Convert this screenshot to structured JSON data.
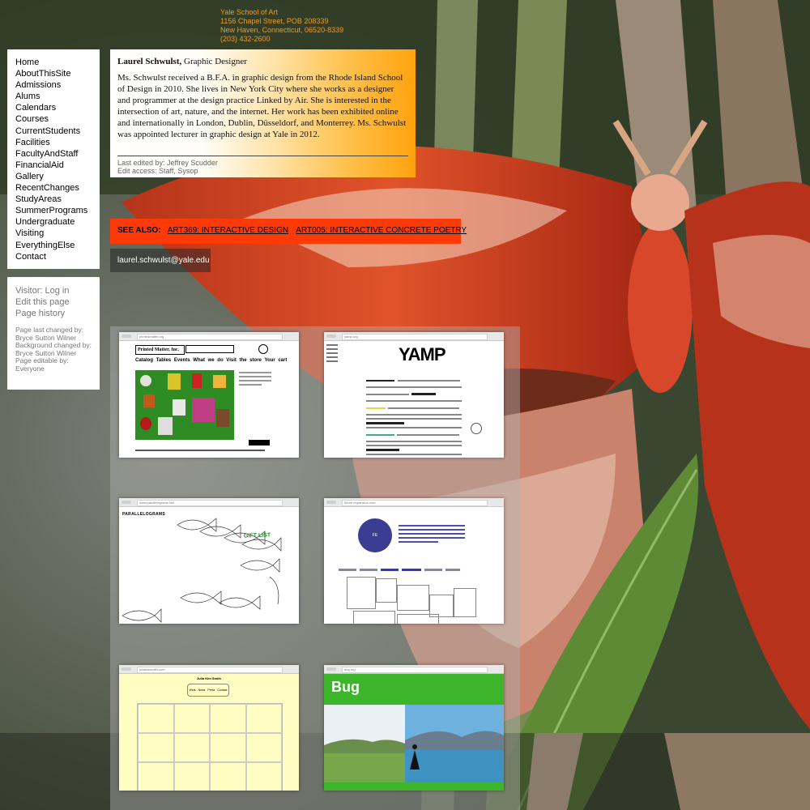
{
  "address": {
    "line1": "Yale School of Art",
    "line2": "1156 Chapel Street, POB 208339",
    "line3": "New Haven, Connecticut, 06520-8339",
    "line4": "(203) 432-2600"
  },
  "nav": {
    "items": [
      "Home",
      "AboutThisSite",
      "Admissions",
      "Alums",
      "Calendars",
      "Courses",
      "CurrentStudents",
      "Facilities",
      "FacultyAndStaff",
      "FinancialAid",
      "Gallery",
      "RecentChanges",
      "StudyAreas",
      "SummerPrograms",
      "Undergraduate",
      "Visiting",
      "EverythingElse",
      "Contact"
    ]
  },
  "meta": {
    "login": "Visitor: Log in",
    "edit": "Edit this page",
    "history": "Page history",
    "changed_label": "Page last changed by:",
    "changed_by": "Bryce Sutton Wilner",
    "bg_label": "Background changed by:",
    "bg_by": "Bryce Sutton Wilner",
    "editable_label": "Page editable by:",
    "editable_by": "Everyone"
  },
  "bio": {
    "name": "Laurel Schwulst,",
    "role": " Graphic Designer",
    "text": "Ms. Schwulst received a B.F.A. in graphic design from the Rhode Island School of Design in 2010. She lives in New York City where she works as a designer and programmer at the design practice Linked by Air. She is interested in the intersection of art, nature, and the internet. Her work has been exhibited online and internationally in London, Dublin, Düsseldorf, and Monterrey. Ms. Schwulst was appointed lecturer in graphic design at Yale in 2012.",
    "last_edited": "Last edited by: Jeffrey Scudder",
    "edit_access": "Edit access: Staff, Sysop"
  },
  "see_also": {
    "label": "SEE ALSO:",
    "links": [
      "ART369: INTERACTIVE DESIGN",
      "ART005: INTERACTIVE CONCRETE POETRY"
    ]
  },
  "email": "laurel.schwulst@yale.edu",
  "thumbs": {
    "t1": {
      "url": "printedmatter.org",
      "title": "Printed Matter, Inc.",
      "menu": [
        "Catalog",
        "Tables",
        "Events",
        "What we do",
        "Visit the store",
        "Your cart"
      ],
      "gift": "GIFT LIST"
    },
    "t2": {
      "url": "yamp.org",
      "title": "YAMP"
    },
    "t3": {
      "url": "www.parallelograms.info",
      "title": "PARALLELOGRAMS",
      "gift": "GIFT LIST"
    },
    "t4": {
      "url": "future-expansion.com",
      "logo": "FE"
    },
    "t5": {
      "url": "juliakimsmith.com",
      "title": "Julia Kim Smith",
      "menu": [
        "Work",
        "News",
        "Press",
        "Contact"
      ]
    },
    "t6": {
      "url": "bug.org",
      "title": "Bug"
    }
  },
  "colors": {
    "address": "#f39a1e",
    "see_also_bar": "#ff3a06",
    "bug_green": "#3db52a"
  }
}
